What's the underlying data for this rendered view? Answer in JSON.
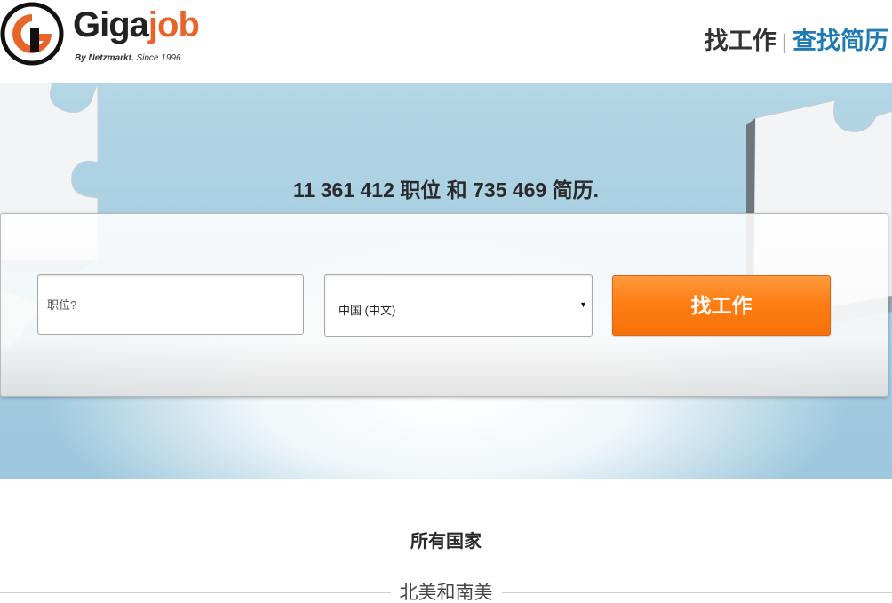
{
  "brand": {
    "name_part1": "Giga",
    "name_part2": "job",
    "tagline_bold": "By Netzmarkt.",
    "tagline_rest": " Since 1996.",
    "logo_icon": "gigajob-logo-icon",
    "accent_color": "#e8652a"
  },
  "nav": {
    "find_job": "找工作",
    "separator": "|",
    "find_cv": "查找简历",
    "link_color": "#1f7bb3"
  },
  "hero": {
    "headline": "11 361 412 职位 和 735 469 简历."
  },
  "search": {
    "job_placeholder": "职位?",
    "job_value": "",
    "country_selected": "中国 (中文)",
    "dropdown_icon": "caret-down-icon",
    "submit_label": "找工作",
    "button_color": "#ff7e13"
  },
  "countries": {
    "title": "所有国家",
    "region": "北美和南美"
  }
}
